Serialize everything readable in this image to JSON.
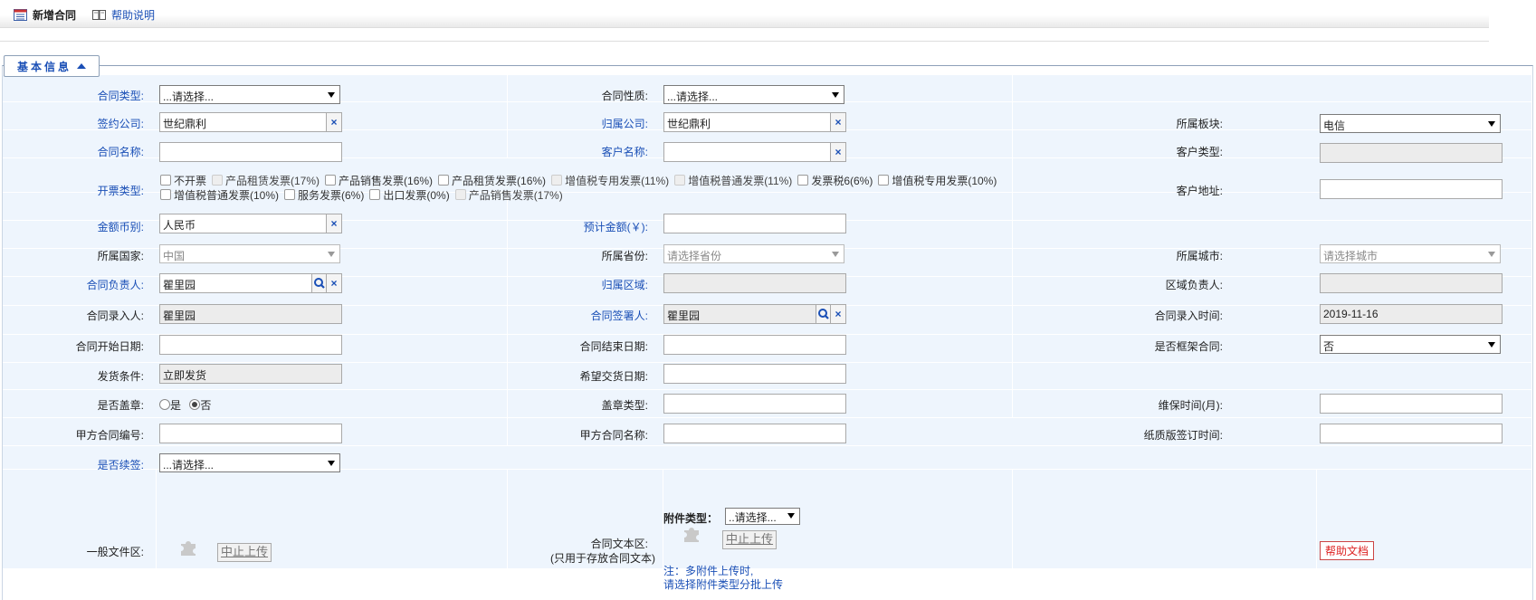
{
  "toolbar": {
    "new_label": "新增合同",
    "help_label": "帮助说明"
  },
  "section": {
    "title": "基本信息"
  },
  "fields": {
    "contract_type": {
      "label": "合同类型:",
      "value": "...请选择..."
    },
    "contract_nature": {
      "label": "合同性质:",
      "value": "...请选择..."
    },
    "sign_company": {
      "label": "签约公司:",
      "value": "世纪鼎利"
    },
    "belong_company": {
      "label": "归属公司:",
      "value": "世纪鼎利"
    },
    "belong_board": {
      "label": "所属板块:",
      "value": "电信"
    },
    "contract_name": {
      "label": "合同名称:",
      "value": ""
    },
    "customer_name": {
      "label": "客户名称:",
      "value": ""
    },
    "customer_type": {
      "label": "客户类型:",
      "value": ""
    },
    "invoice_type": {
      "label": "开票类型:",
      "options": [
        "不开票",
        "产品租赁发票(17%)",
        "产品销售发票(16%)",
        "产品租赁发票(16%)",
        "增值税专用发票(11%)",
        "增值税普通发票(11%)",
        "发票税6(6%)",
        "增值税专用发票(10%)",
        "增值税普通发票(10%)",
        "服务发票(6%)",
        "出口发票(0%)",
        "产品销售发票(17%)"
      ]
    },
    "customer_address": {
      "label": "客户地址:",
      "value": ""
    },
    "currency": {
      "label": "金额币别:",
      "value": "人民币"
    },
    "estimated_amount": {
      "label": "预计金额(￥):",
      "value": ""
    },
    "country": {
      "label": "所属国家:",
      "value": "中国"
    },
    "province": {
      "label": "所属省份:",
      "value": "请选择省份"
    },
    "city": {
      "label": "所属城市:",
      "value": "请选择城市"
    },
    "contract_owner": {
      "label": "合同负责人:",
      "value": "瞿里园"
    },
    "belong_region": {
      "label": "归属区域:",
      "value": ""
    },
    "region_owner": {
      "label": "区域负责人:",
      "value": ""
    },
    "entry_person": {
      "label": "合同录入人:",
      "value": "瞿里园"
    },
    "signer": {
      "label": "合同签署人:",
      "value": "瞿里园"
    },
    "entry_time": {
      "label": "合同录入时间:",
      "value": "2019-11-16"
    },
    "start_date": {
      "label": "合同开始日期:",
      "value": ""
    },
    "end_date": {
      "label": "合同结束日期:",
      "value": ""
    },
    "framework": {
      "label": "是否框架合同:",
      "value": "否"
    },
    "ship_condition": {
      "label": "发货条件:",
      "value": "立即发货"
    },
    "delivery_date": {
      "label": "希望交货日期:",
      "value": ""
    },
    "stamp": {
      "label": "是否盖章:",
      "yes": "是",
      "no": "否"
    },
    "stamp_type": {
      "label": "盖章类型:",
      "value": ""
    },
    "warranty": {
      "label": "维保时间(月):",
      "value": ""
    },
    "party_a_no": {
      "label": "甲方合同编号:",
      "value": ""
    },
    "party_a_name": {
      "label": "甲方合同名称:",
      "value": ""
    },
    "paper_sign_time": {
      "label": "纸质版签订时间:",
      "value": ""
    },
    "renew": {
      "label": "是否续签:",
      "value": "...请选择..."
    }
  },
  "files": {
    "general_label": "一般文件区:",
    "contract_label": "合同文本区:",
    "contract_sub": "(只用于存放合同文本)",
    "attach_type_label": "附件类型：",
    "attach_type_value": "..请选择...",
    "stop_upload": "中止上传",
    "note_line1": "注：多附件上传时,",
    "note_line2": "请选择附件类型分批上传",
    "help_doc": "帮助文档"
  },
  "colors": {
    "required_label": "#1a4fb6",
    "row_bg": "#eef5fd"
  }
}
